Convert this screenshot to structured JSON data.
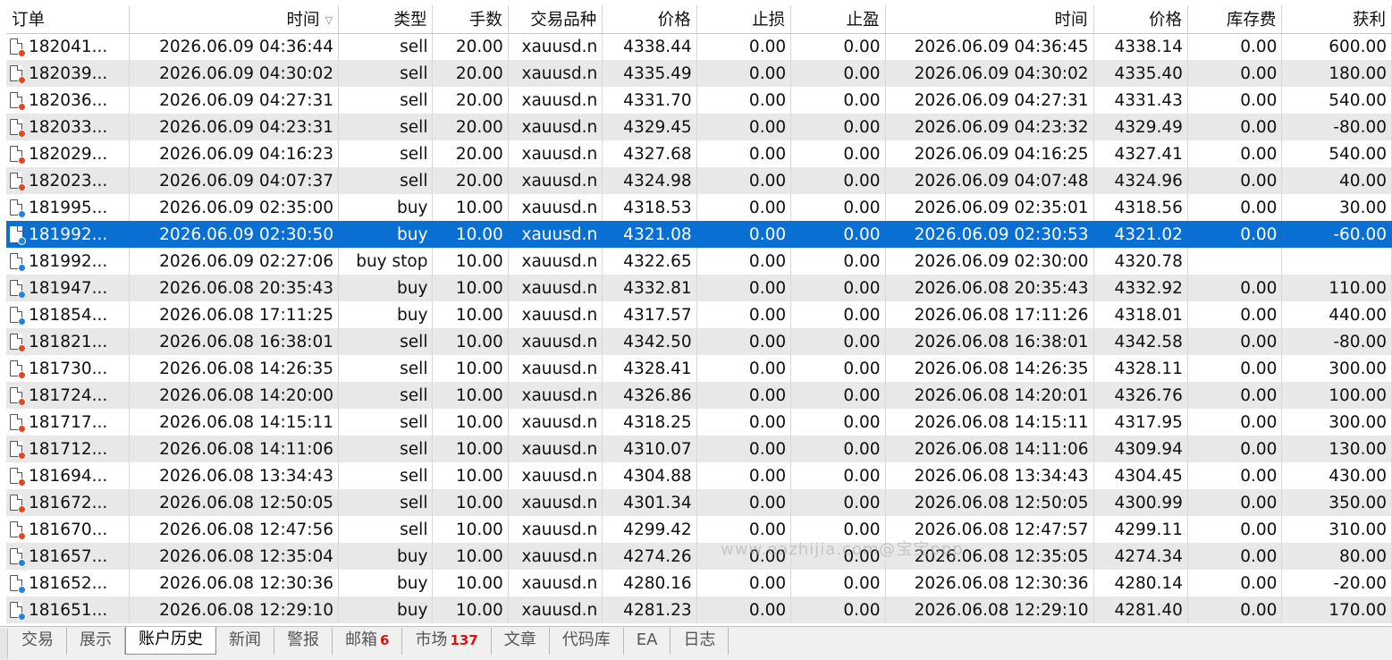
{
  "columns": {
    "order": "订单",
    "open_time": "时间",
    "type": "类型",
    "volume": "手数",
    "symbol": "交易品种",
    "open_price": "价格",
    "sl": "止损",
    "tp": "止盈",
    "close_time": "时间",
    "close_price": "价格",
    "swap": "库存费",
    "profit": "获利"
  },
  "rows": [
    {
      "order": "182041...",
      "open_time": "2026.06.09 04:36:44",
      "type": "sell",
      "volume": "20.00",
      "symbol": "xauusd.n",
      "open_price": "4338.44",
      "sl": "0.00",
      "tp": "0.00",
      "close_time": "2026.06.09 04:36:45",
      "close_price": "4338.14",
      "swap": "0.00",
      "profit": "600.00"
    },
    {
      "order": "182039...",
      "open_time": "2026.06.09 04:30:02",
      "type": "sell",
      "volume": "20.00",
      "symbol": "xauusd.n",
      "open_price": "4335.49",
      "sl": "0.00",
      "tp": "0.00",
      "close_time": "2026.06.09 04:30:02",
      "close_price": "4335.40",
      "swap": "0.00",
      "profit": "180.00"
    },
    {
      "order": "182036...",
      "open_time": "2026.06.09 04:27:31",
      "type": "sell",
      "volume": "20.00",
      "symbol": "xauusd.n",
      "open_price": "4331.70",
      "sl": "0.00",
      "tp": "0.00",
      "close_time": "2026.06.09 04:27:31",
      "close_price": "4331.43",
      "swap": "0.00",
      "profit": "540.00"
    },
    {
      "order": "182033...",
      "open_time": "2026.06.09 04:23:31",
      "type": "sell",
      "volume": "20.00",
      "symbol": "xauusd.n",
      "open_price": "4329.45",
      "sl": "0.00",
      "tp": "0.00",
      "close_time": "2026.06.09 04:23:32",
      "close_price": "4329.49",
      "swap": "0.00",
      "profit": "-80.00"
    },
    {
      "order": "182029...",
      "open_time": "2026.06.09 04:16:23",
      "type": "sell",
      "volume": "20.00",
      "symbol": "xauusd.n",
      "open_price": "4327.68",
      "sl": "0.00",
      "tp": "0.00",
      "close_time": "2026.06.09 04:16:25",
      "close_price": "4327.41",
      "swap": "0.00",
      "profit": "540.00"
    },
    {
      "order": "182023...",
      "open_time": "2026.06.09 04:07:37",
      "type": "sell",
      "volume": "20.00",
      "symbol": "xauusd.n",
      "open_price": "4324.98",
      "sl": "0.00",
      "tp": "0.00",
      "close_time": "2026.06.09 04:07:48",
      "close_price": "4324.96",
      "swap": "0.00",
      "profit": "40.00"
    },
    {
      "order": "181995...",
      "open_time": "2026.06.09 02:35:00",
      "type": "buy",
      "volume": "10.00",
      "symbol": "xauusd.n",
      "open_price": "4318.53",
      "sl": "0.00",
      "tp": "0.00",
      "close_time": "2026.06.09 02:35:01",
      "close_price": "4318.56",
      "swap": "0.00",
      "profit": "30.00"
    },
    {
      "order": "181992...",
      "open_time": "2026.06.09 02:30:50",
      "type": "buy",
      "volume": "10.00",
      "symbol": "xauusd.n",
      "open_price": "4321.08",
      "sl": "0.00",
      "tp": "0.00",
      "close_time": "2026.06.09 02:30:53",
      "close_price": "4321.02",
      "swap": "0.00",
      "profit": "-60.00"
    },
    {
      "order": "181992...",
      "open_time": "2026.06.09 02:27:06",
      "type": "buy stop",
      "volume": "10.00",
      "symbol": "xauusd.n",
      "open_price": "4322.65",
      "sl": "0.00",
      "tp": "0.00",
      "close_time": "2026.06.09 02:30:00",
      "close_price": "4320.78",
      "swap": "",
      "profit": ""
    },
    {
      "order": "181947...",
      "open_time": "2026.06.08 20:35:43",
      "type": "buy",
      "volume": "10.00",
      "symbol": "xauusd.n",
      "open_price": "4332.81",
      "sl": "0.00",
      "tp": "0.00",
      "close_time": "2026.06.08 20:35:43",
      "close_price": "4332.92",
      "swap": "0.00",
      "profit": "110.00"
    },
    {
      "order": "181854...",
      "open_time": "2026.06.08 17:11:25",
      "type": "buy",
      "volume": "10.00",
      "symbol": "xauusd.n",
      "open_price": "4317.57",
      "sl": "0.00",
      "tp": "0.00",
      "close_time": "2026.06.08 17:11:26",
      "close_price": "4318.01",
      "swap": "0.00",
      "profit": "440.00"
    },
    {
      "order": "181821...",
      "open_time": "2026.06.08 16:38:01",
      "type": "sell",
      "volume": "10.00",
      "symbol": "xauusd.n",
      "open_price": "4342.50",
      "sl": "0.00",
      "tp": "0.00",
      "close_time": "2026.06.08 16:38:01",
      "close_price": "4342.58",
      "swap": "0.00",
      "profit": "-80.00"
    },
    {
      "order": "181730...",
      "open_time": "2026.06.08 14:26:35",
      "type": "sell",
      "volume": "10.00",
      "symbol": "xauusd.n",
      "open_price": "4328.41",
      "sl": "0.00",
      "tp": "0.00",
      "close_time": "2026.06.08 14:26:35",
      "close_price": "4328.11",
      "swap": "0.00",
      "profit": "300.00"
    },
    {
      "order": "181724...",
      "open_time": "2026.06.08 14:20:00",
      "type": "sell",
      "volume": "10.00",
      "symbol": "xauusd.n",
      "open_price": "4326.86",
      "sl": "0.00",
      "tp": "0.00",
      "close_time": "2026.06.08 14:20:01",
      "close_price": "4326.76",
      "swap": "0.00",
      "profit": "100.00"
    },
    {
      "order": "181717...",
      "open_time": "2026.06.08 14:15:11",
      "type": "sell",
      "volume": "10.00",
      "symbol": "xauusd.n",
      "open_price": "4318.25",
      "sl": "0.00",
      "tp": "0.00",
      "close_time": "2026.06.08 14:15:11",
      "close_price": "4317.95",
      "swap": "0.00",
      "profit": "300.00"
    },
    {
      "order": "181712...",
      "open_time": "2026.06.08 14:11:06",
      "type": "sell",
      "volume": "10.00",
      "symbol": "xauusd.n",
      "open_price": "4310.07",
      "sl": "0.00",
      "tp": "0.00",
      "close_time": "2026.06.08 14:11:06",
      "close_price": "4309.94",
      "swap": "0.00",
      "profit": "130.00"
    },
    {
      "order": "181694...",
      "open_time": "2026.06.08 13:34:43",
      "type": "sell",
      "volume": "10.00",
      "symbol": "xauusd.n",
      "open_price": "4304.88",
      "sl": "0.00",
      "tp": "0.00",
      "close_time": "2026.06.08 13:34:43",
      "close_price": "4304.45",
      "swap": "0.00",
      "profit": "430.00"
    },
    {
      "order": "181672...",
      "open_time": "2026.06.08 12:50:05",
      "type": "sell",
      "volume": "10.00",
      "symbol": "xauusd.n",
      "open_price": "4301.34",
      "sl": "0.00",
      "tp": "0.00",
      "close_time": "2026.06.08 12:50:05",
      "close_price": "4300.99",
      "swap": "0.00",
      "profit": "350.00"
    },
    {
      "order": "181670...",
      "open_time": "2026.06.08 12:47:56",
      "type": "sell",
      "volume": "10.00",
      "symbol": "xauusd.n",
      "open_price": "4299.42",
      "sl": "0.00",
      "tp": "0.00",
      "close_time": "2026.06.08 12:47:57",
      "close_price": "4299.11",
      "swap": "0.00",
      "profit": "310.00"
    },
    {
      "order": "181657...",
      "open_time": "2026.06.08 12:35:04",
      "type": "buy",
      "volume": "10.00",
      "symbol": "xauusd.n",
      "open_price": "4274.26",
      "sl": "0.00",
      "tp": "0.00",
      "close_time": "2026.06.08 12:35:05",
      "close_price": "4274.34",
      "swap": "0.00",
      "profit": "80.00"
    },
    {
      "order": "181652...",
      "open_time": "2026.06.08 12:30:36",
      "type": "buy",
      "volume": "10.00",
      "symbol": "xauusd.n",
      "open_price": "4280.16",
      "sl": "0.00",
      "tp": "0.00",
      "close_time": "2026.06.08 12:30:36",
      "close_price": "4280.14",
      "swap": "0.00",
      "profit": "-20.00"
    },
    {
      "order": "181651...",
      "open_time": "2026.06.08 12:29:10",
      "type": "buy",
      "volume": "10.00",
      "symbol": "xauusd.n",
      "open_price": "4281.23",
      "sl": "0.00",
      "tp": "0.00",
      "close_time": "2026.06.08 12:29:10",
      "close_price": "4281.40",
      "swap": "0.00",
      "profit": "170.00"
    }
  ],
  "selected_order_row": "181992... 2026.06.09 02:30:50",
  "tabs": [
    {
      "label": "交易",
      "badge": ""
    },
    {
      "label": "展示",
      "badge": ""
    },
    {
      "label": "账户历史",
      "badge": "",
      "active": true
    },
    {
      "label": "新闻",
      "badge": ""
    },
    {
      "label": "警报",
      "badge": ""
    },
    {
      "label": "邮箱",
      "badge": "6"
    },
    {
      "label": "市场",
      "badge": "137"
    },
    {
      "label": "文章",
      "badge": ""
    },
    {
      "label": "代码库",
      "badge": ""
    },
    {
      "label": "EA",
      "badge": ""
    },
    {
      "label": "日志",
      "badge": ""
    }
  ],
  "watermark": "www.eazhijia.com@宝宝ppp",
  "colors": {
    "selection": "#0a6fd3",
    "sell_dot": "#e2471f",
    "buy_dot": "#1f84de",
    "badge": "#d01818",
    "stripe": "#e8e8e8"
  }
}
